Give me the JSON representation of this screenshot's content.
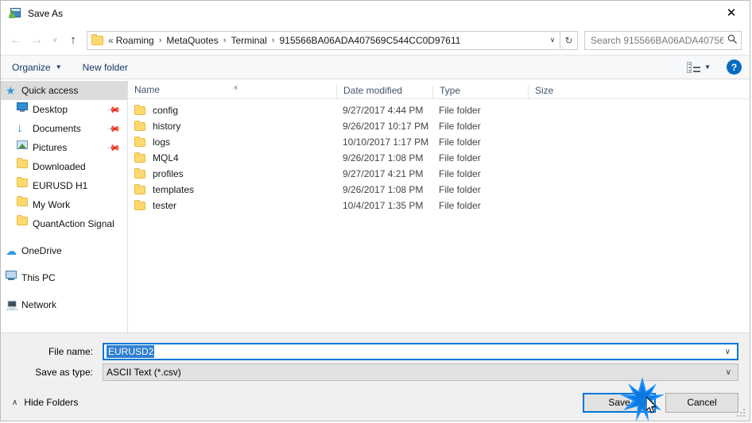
{
  "window": {
    "title": "Save As",
    "icon": "save-as-icon",
    "close_label": "✕"
  },
  "nav": {
    "back_icon": "←",
    "forward_icon": "→",
    "recent_icon": "∨",
    "up_icon": "↑",
    "refresh_icon": "↻"
  },
  "address": {
    "folder_icon": "folder-icon",
    "leading_separator": "«",
    "crumbs": [
      "Roaming",
      "MetaQuotes",
      "Terminal",
      "915566BA06ADA407569C544CC0D97611"
    ],
    "separator": "›",
    "dropdown_icon": "∨"
  },
  "search": {
    "placeholder": "Search 915566BA06ADA40756...",
    "icon": "🔍"
  },
  "toolbar": {
    "organize_label": "Organize",
    "organize_caret": "▼",
    "new_folder_label": "New folder",
    "view_caret": "▼",
    "help_label": "?"
  },
  "sidebar": {
    "items": [
      {
        "label": "Quick access",
        "icon": "star-icon",
        "selected": true,
        "indent": false,
        "pinned": false
      },
      {
        "label": "Desktop",
        "icon": "desktop-icon",
        "selected": false,
        "indent": true,
        "pinned": true
      },
      {
        "label": "Documents",
        "icon": "download-arrow-icon",
        "selected": false,
        "indent": true,
        "pinned": true
      },
      {
        "label": "Pictures",
        "icon": "picture-icon",
        "selected": false,
        "indent": true,
        "pinned": true
      },
      {
        "label": "Downloaded",
        "icon": "folder-icon",
        "selected": false,
        "indent": true,
        "pinned": false
      },
      {
        "label": "EURUSD H1",
        "icon": "folder-icon",
        "selected": false,
        "indent": true,
        "pinned": false
      },
      {
        "label": "My Work",
        "icon": "folder-icon",
        "selected": false,
        "indent": true,
        "pinned": false
      },
      {
        "label": "QuantAction Signal",
        "icon": "folder-icon",
        "selected": false,
        "indent": true,
        "pinned": false
      },
      {
        "label": "OneDrive",
        "icon": "cloud-icon",
        "selected": false,
        "indent": false,
        "pinned": false
      },
      {
        "label": "This PC",
        "icon": "pc-icon",
        "selected": false,
        "indent": false,
        "pinned": false
      },
      {
        "label": "Network",
        "icon": "network-icon",
        "selected": false,
        "indent": false,
        "pinned": false
      }
    ],
    "pin_glyph": "📌"
  },
  "filelist": {
    "columns": [
      "Name",
      "Date modified",
      "Type",
      "Size"
    ],
    "sort_caret": "ⱏ",
    "rows": [
      {
        "name": "config",
        "date": "9/27/2017 4:44 PM",
        "type": "File folder",
        "size": ""
      },
      {
        "name": "history",
        "date": "9/26/2017 10:17 PM",
        "type": "File folder",
        "size": ""
      },
      {
        "name": "logs",
        "date": "10/10/2017 1:17 PM",
        "type": "File folder",
        "size": ""
      },
      {
        "name": "MQL4",
        "date": "9/26/2017 1:08 PM",
        "type": "File folder",
        "size": ""
      },
      {
        "name": "profiles",
        "date": "9/27/2017 4:21 PM",
        "type": "File folder",
        "size": ""
      },
      {
        "name": "templates",
        "date": "9/26/2017 1:08 PM",
        "type": "File folder",
        "size": ""
      },
      {
        "name": "tester",
        "date": "10/4/2017 1:35 PM",
        "type": "File folder",
        "size": ""
      }
    ]
  },
  "form": {
    "filename_label": "File name:",
    "filename_value": "EURUSD2",
    "savetype_label": "Save as type:",
    "savetype_value": "ASCII Text (*.csv)",
    "chevron": "∨"
  },
  "footer": {
    "hide_folders_label": "Hide Folders",
    "hide_caret": "∧",
    "save_label": "Save",
    "cancel_label": "Cancel"
  }
}
